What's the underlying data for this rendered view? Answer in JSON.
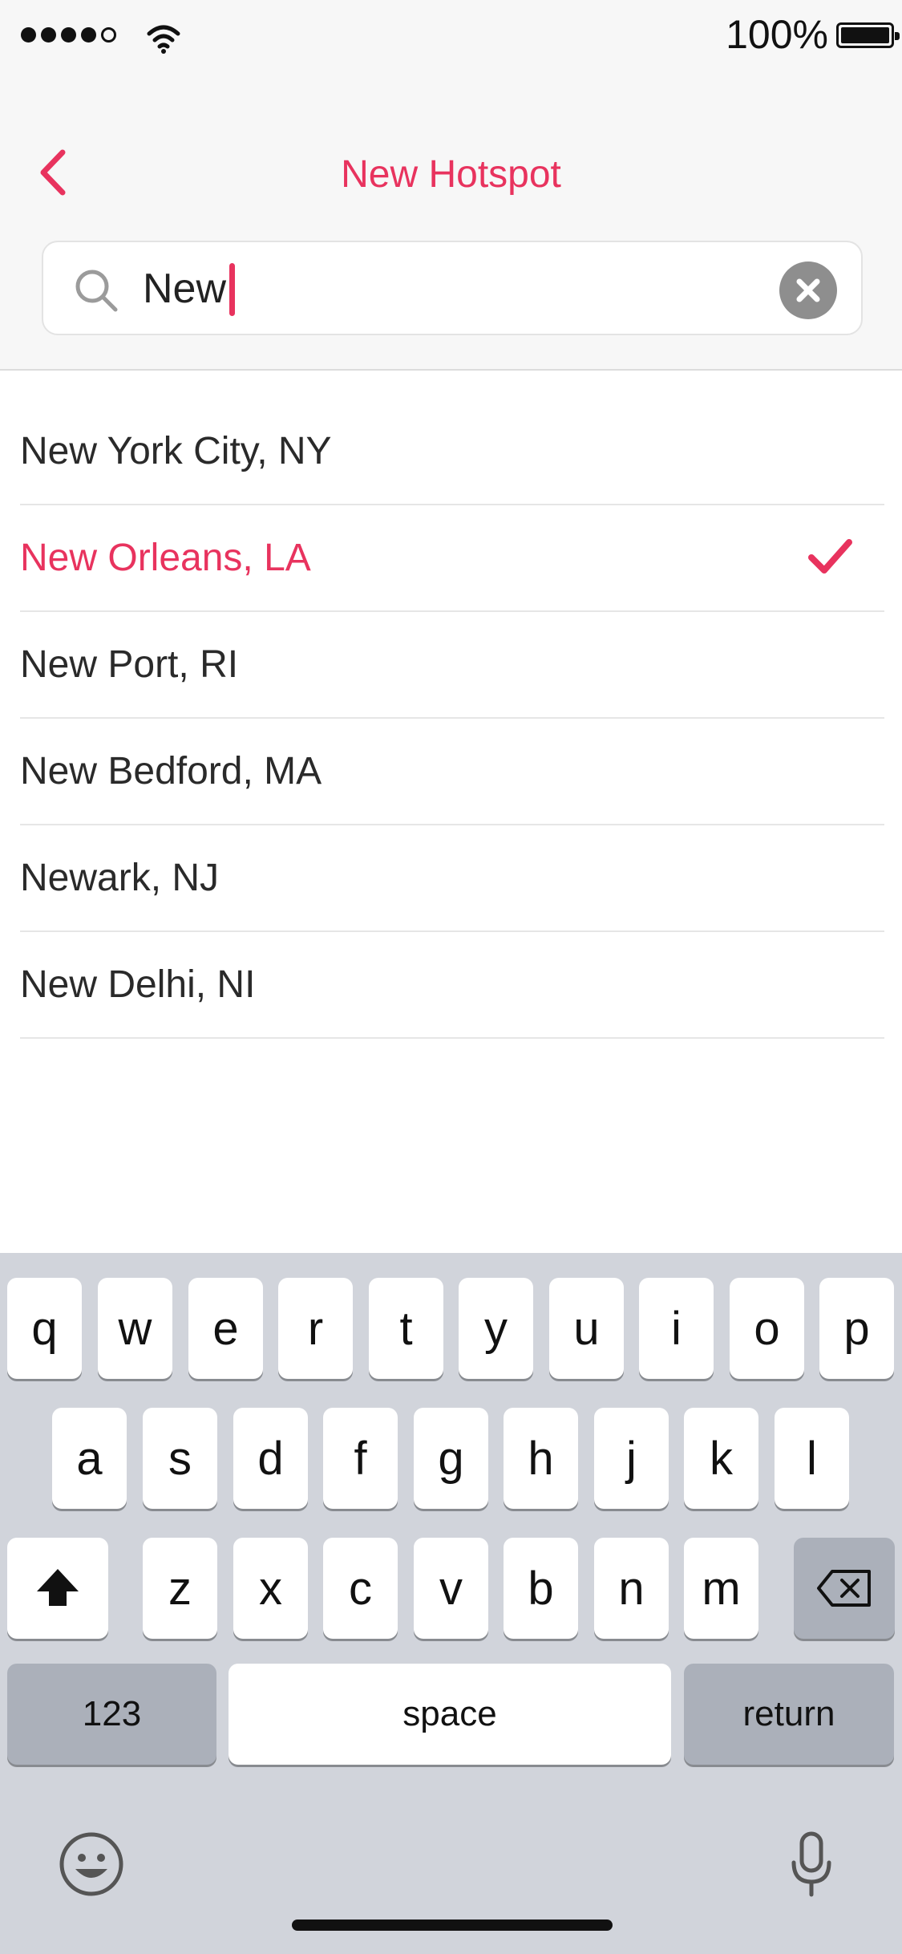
{
  "status_bar": {
    "battery_text": "100%"
  },
  "nav": {
    "title": "New Hotspot"
  },
  "search": {
    "value": "New"
  },
  "results": [
    {
      "label": "New York City, NY",
      "selected": false
    },
    {
      "label": "New Orleans, LA",
      "selected": true
    },
    {
      "label": "New Port, RI",
      "selected": false
    },
    {
      "label": "New Bedford, MA",
      "selected": false
    },
    {
      "label": "Newark, NJ",
      "selected": false
    },
    {
      "label": "New Delhi, NI",
      "selected": false
    }
  ],
  "keyboard": {
    "row1": [
      "q",
      "w",
      "e",
      "r",
      "t",
      "y",
      "u",
      "i",
      "o",
      "p"
    ],
    "row2": [
      "a",
      "s",
      "d",
      "f",
      "g",
      "h",
      "j",
      "k",
      "l"
    ],
    "row3": [
      "z",
      "x",
      "c",
      "v",
      "b",
      "n",
      "m"
    ],
    "numbers_label": "123",
    "space_label": "space",
    "return_label": "return"
  },
  "icons": {
    "back": "chevron-left-icon",
    "search": "magnifier-icon",
    "clear": "x-circle-icon",
    "check": "checkmark-icon",
    "shift": "shift-arrow-icon",
    "delete": "backspace-icon",
    "emoji": "smiley-icon",
    "mic": "microphone-icon"
  },
  "colors": {
    "accent": "#e8335e",
    "keyboard_bg": "#d1d4db",
    "dark_key": "#abb0ba"
  }
}
